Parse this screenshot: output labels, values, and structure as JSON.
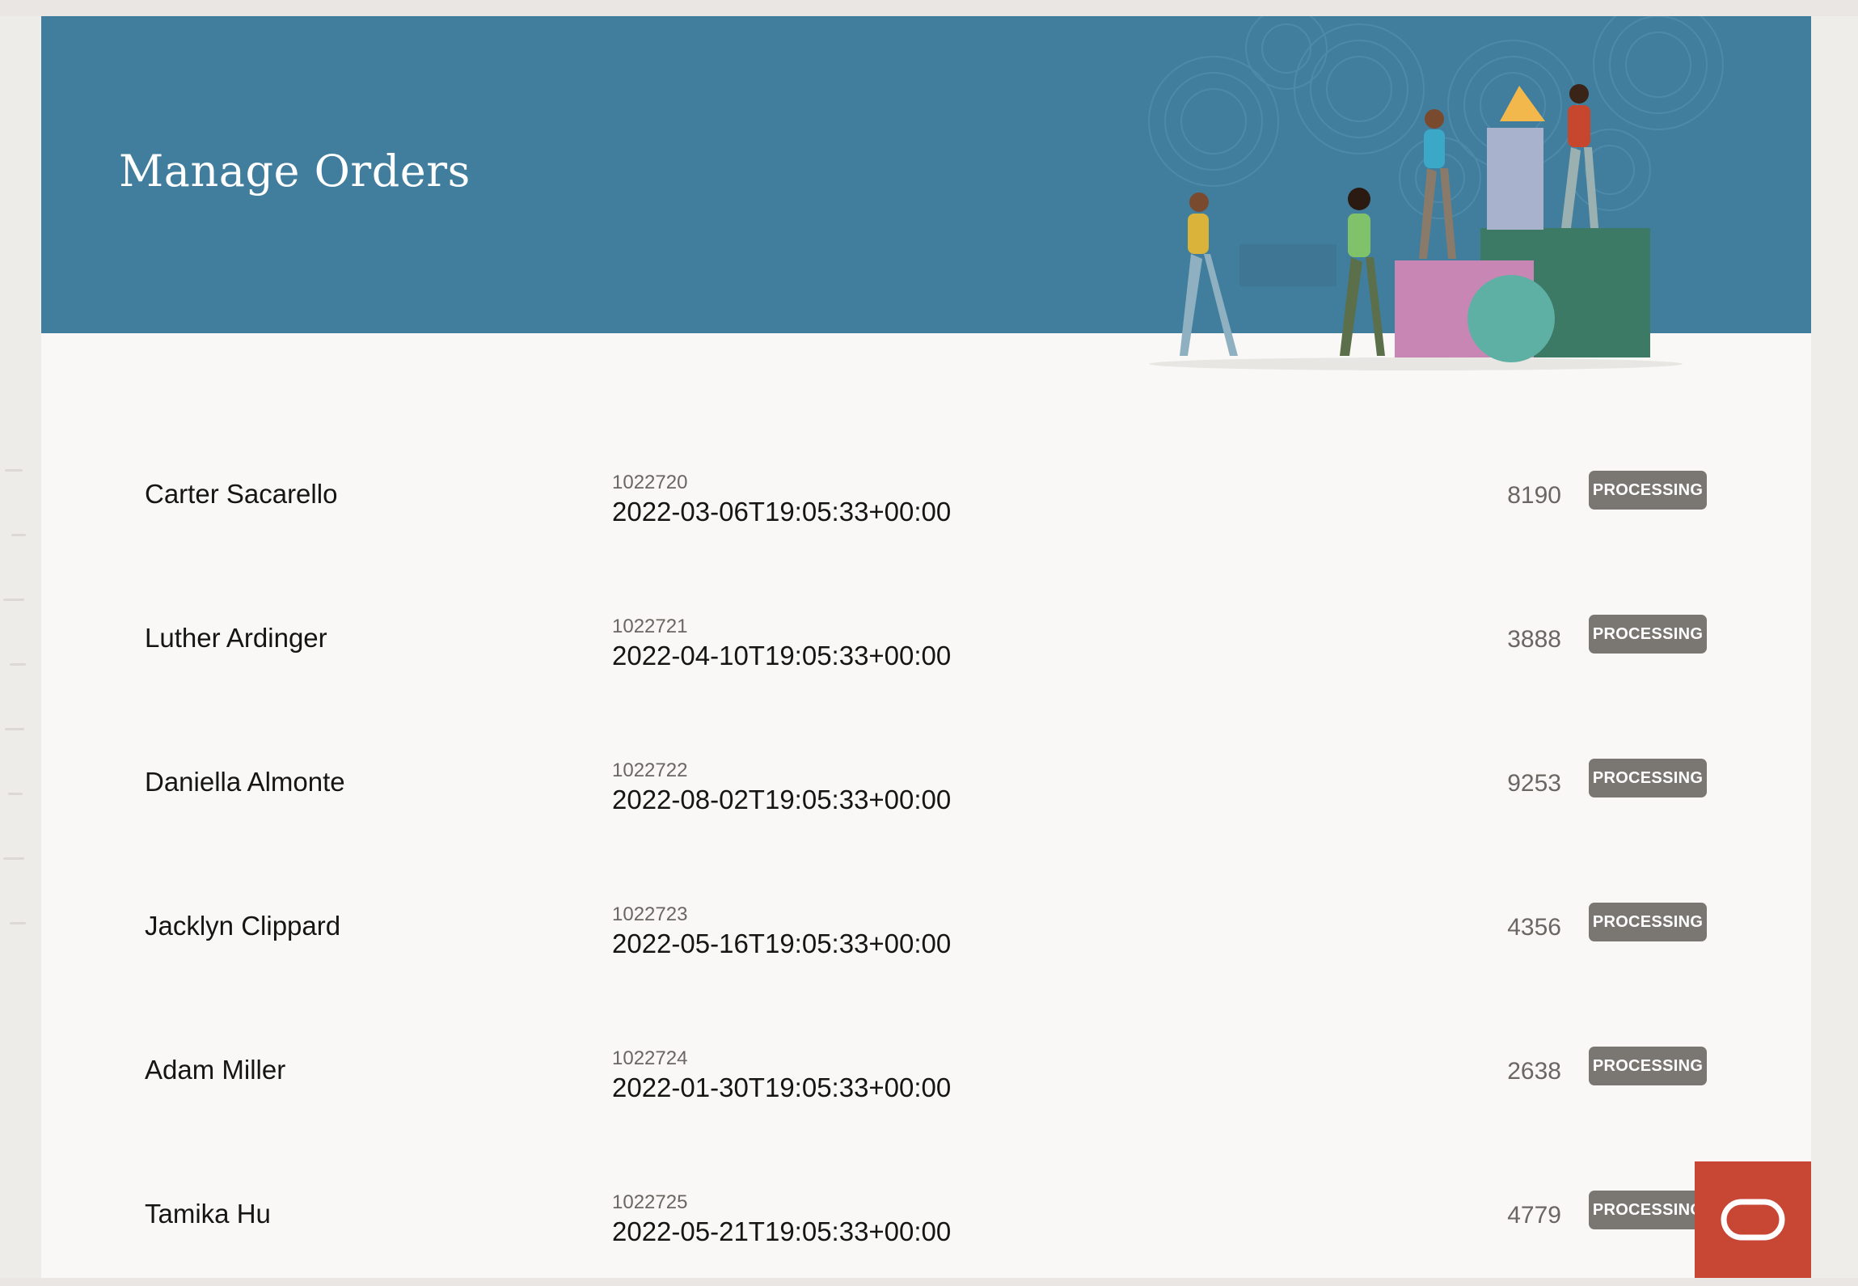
{
  "page": {
    "title": "Manage Orders"
  },
  "orders": [
    {
      "customer": "Carter Sacarello",
      "order_id": "1022720",
      "date": "2022-03-06T19:05:33+00:00",
      "amount": "8190",
      "status": "PROCESSING"
    },
    {
      "customer": "Luther Ardinger",
      "order_id": "1022721",
      "date": "2022-04-10T19:05:33+00:00",
      "amount": "3888",
      "status": "PROCESSING"
    },
    {
      "customer": "Daniella Almonte",
      "order_id": "1022722",
      "date": "2022-08-02T19:05:33+00:00",
      "amount": "9253",
      "status": "PROCESSING"
    },
    {
      "customer": "Jacklyn Clippard",
      "order_id": "1022723",
      "date": "2022-05-16T19:05:33+00:00",
      "amount": "4356",
      "status": "PROCESSING"
    },
    {
      "customer": "Adam Miller",
      "order_id": "1022724",
      "date": "2022-01-30T19:05:33+00:00",
      "amount": "2638",
      "status": "PROCESSING"
    },
    {
      "customer": "Tamika Hu",
      "order_id": "1022725",
      "date": "2022-05-21T19:05:33+00:00",
      "amount": "4779",
      "status": "PROCESSING"
    }
  ],
  "colors": {
    "banner": "#417e9e",
    "status_badge": "#7a7672",
    "oracle_red": "#c74634"
  },
  "icons": {
    "fab": "oracle-logo-icon"
  }
}
